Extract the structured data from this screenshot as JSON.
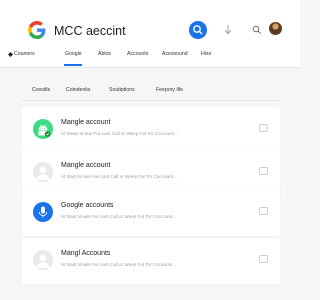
{
  "header": {
    "title": "MCC aeccint",
    "brand_color": "#1a73e8",
    "icons": [
      "google-logo-icon",
      "search-icon",
      "download-icon",
      "search-small-icon",
      "avatar"
    ]
  },
  "tabs": {
    "items": [
      {
        "label": "Couniers"
      },
      {
        "label": "Google"
      },
      {
        "label": "Ablos"
      },
      {
        "label": "Accounts"
      },
      {
        "label": "Acessound"
      },
      {
        "label": "Hiso"
      }
    ],
    "active_index": 1
  },
  "filters": {
    "items": [
      {
        "label": "Cvesitls"
      },
      {
        "label": "Coindenks"
      },
      {
        "label": "Soutiptions"
      },
      {
        "label": "Feepory life"
      }
    ]
  },
  "cards": [
    {
      "title": "Mangle account",
      "subtitle": "Al Sleep M ane Far Lant Call or Weep Fal Tor Coccount...",
      "avatar": "android",
      "avatar_color": "#3ddc84"
    },
    {
      "title": "Mangle account",
      "subtitle": "Al Slept M ane Far Lant Call or Weep Fal Tor Coccount...",
      "avatar": "person",
      "avatar_color": "#e8eaed"
    },
    {
      "title": "Google accounts",
      "subtitle": "M Slept M aile Far Lant Call or Weep Fal Tor Coccount...",
      "avatar": "microphone",
      "avatar_color": "#1a73e8"
    },
    {
      "title": "Mangl Accounts",
      "subtitle": "M Slept M alle Far Lant Call or Weep Fal Tor Cocaunts...",
      "avatar": "person",
      "avatar_color": "#e8eaed"
    }
  ]
}
